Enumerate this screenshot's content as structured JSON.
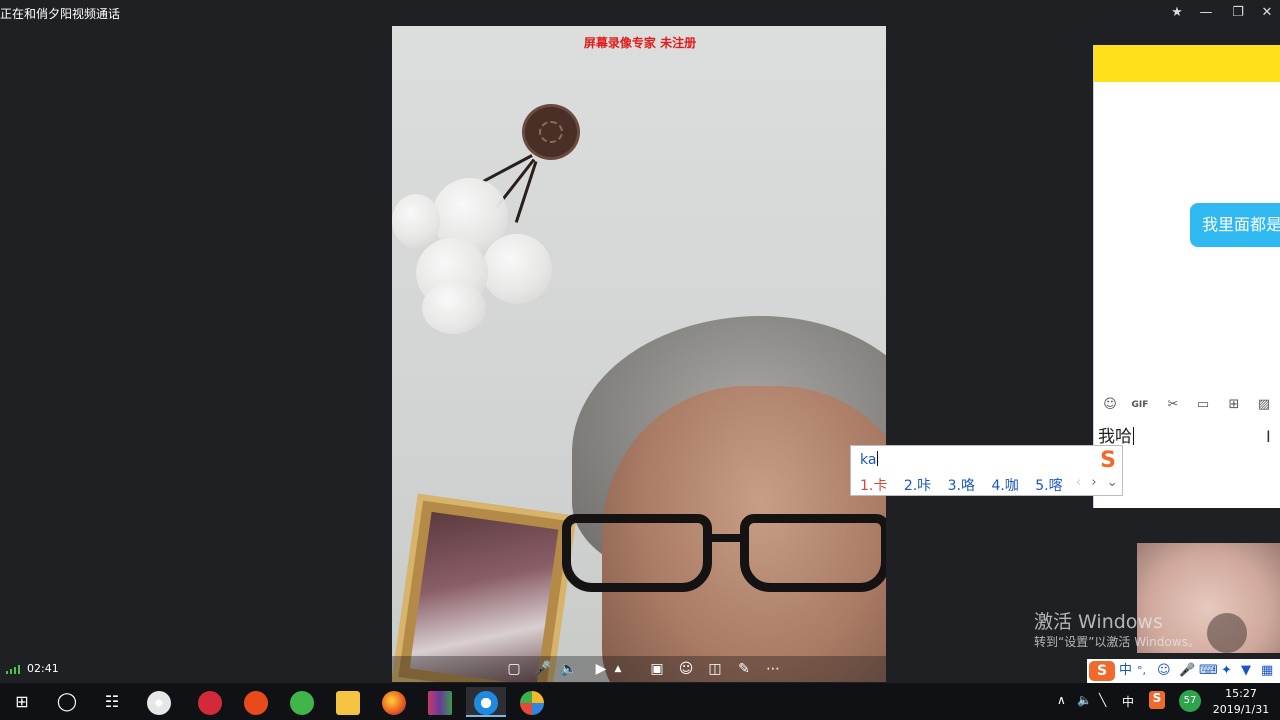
{
  "window": {
    "title": "正在和俏夕阳视频通话",
    "pin_icon": "pin-icon",
    "minimize_icon": "minimize-icon",
    "maximize_icon": "maximize-icon",
    "close_icon": "close-icon"
  },
  "video": {
    "watermark": "屏幕录像专家 未注册",
    "call_timer": "02:41"
  },
  "video_toolbar": {
    "buttons": [
      "message-icon",
      "microphone-icon",
      "speaker-icon",
      "camera-icon",
      "dropdown-arrow-icon",
      "screenshot-icon",
      "effects-icon",
      "layout-icon",
      "edit-icon",
      "more-icon"
    ]
  },
  "chat": {
    "header_color": "#ffe11a",
    "bubble_text": "我里面都是",
    "bubble_color": "#2fb9f0",
    "toolbar_icons": [
      "emoji-icon",
      "gif-icon",
      "scissors-icon",
      "folder-icon",
      "app-icon",
      "image-icon"
    ],
    "input_text": "我哈"
  },
  "ime": {
    "pinyin": "ka",
    "candidates": [
      "1.卡",
      "2.咔",
      "3.咯",
      "4.咖",
      "5.喀"
    ],
    "logo": "S"
  },
  "activate_windows": {
    "title": "激活 Windows",
    "subtitle": "转到“设置”以激活 Windows。"
  },
  "ime_tray": {
    "logo": "S",
    "mode": "中",
    "punct": "°,"
  },
  "taskbar": {
    "start_icon": "windows-start-icon",
    "search_icon": "cortana-circle-icon",
    "taskview_icon": "task-view-icon",
    "lang": "中",
    "battery_pct": "57",
    "time": "15:27",
    "date": "2019/1/31"
  }
}
